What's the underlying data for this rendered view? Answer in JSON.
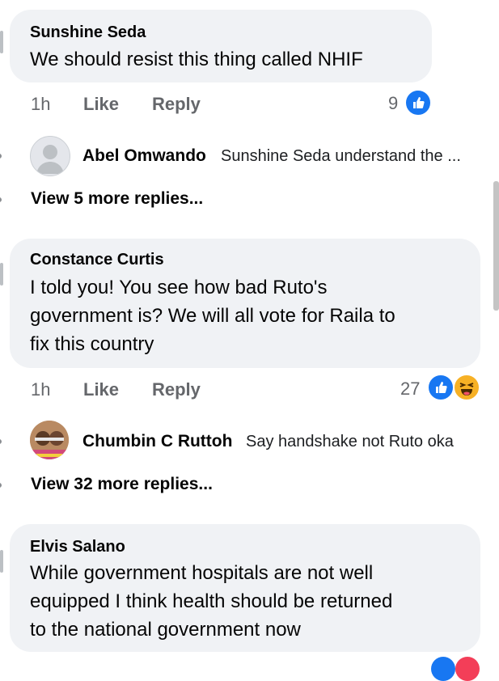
{
  "comments": [
    {
      "author": "Sunshine Seda",
      "text": "We should resist this thing called NHIF",
      "time": "1h",
      "like_label": "Like",
      "reply_label": "Reply",
      "reaction_count": "9",
      "reactions": [
        "like-icon"
      ],
      "reply_preview": {
        "author": "Abel Omwando",
        "text": "Sunshine Seda understand the ..."
      },
      "more_replies": "View 5 more replies..."
    },
    {
      "author": "Constance Curtis",
      "text_lines": [
        "I told you! You see how bad Ruto's",
        "government is? We will all vote for Raila to",
        "fix this country"
      ],
      "time": "1h",
      "like_label": "Like",
      "reply_label": "Reply",
      "reaction_count": "27",
      "reactions": [
        "like-icon",
        "haha-icon"
      ],
      "reply_preview": {
        "author": "Chumbin C Ruttoh",
        "text": "Say handshake not Ruto oka"
      },
      "more_replies": "View 32 more replies..."
    },
    {
      "author": "Elvis Salano",
      "text_lines": [
        "While government hospitals are not well",
        "equipped I think health should be returned",
        "to the national government now"
      ]
    }
  ],
  "colors": {
    "bubble": "#f0f2f5",
    "meta": "#65676b",
    "like_blue": "#1877f2",
    "haha_yellow": "#f7b125"
  }
}
